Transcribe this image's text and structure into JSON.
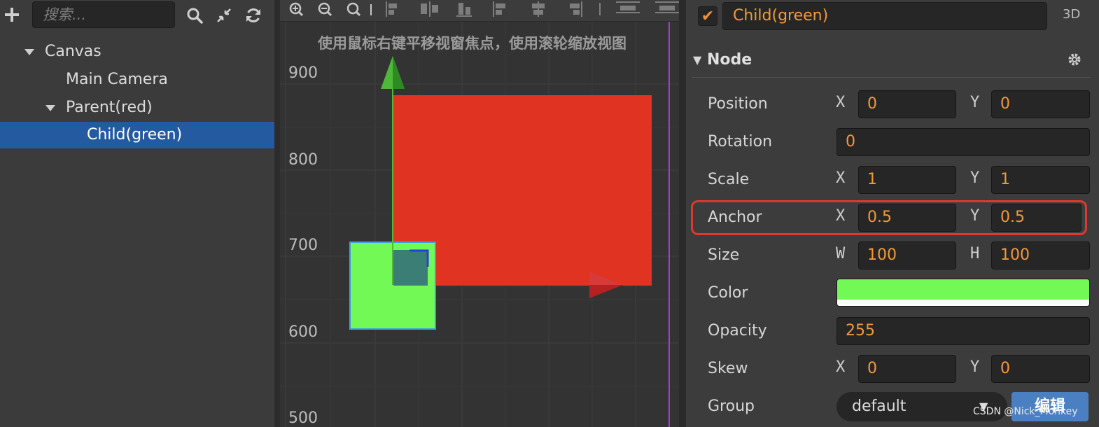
{
  "hierarchy": {
    "search_placeholder": "搜索...",
    "tree": [
      {
        "label": "Canvas",
        "level": 0,
        "expanded": true
      },
      {
        "label": "Main Camera",
        "level": 1
      },
      {
        "label": "Parent(red)",
        "level": 1,
        "expanded": true
      },
      {
        "label": "Child(green)",
        "level": 2,
        "selected": true
      }
    ],
    "icons": [
      "plus-icon",
      "search-icon",
      "collapse-icon",
      "refresh-icon"
    ]
  },
  "scene": {
    "hint": "使用鼠标右键平移视窗焦点，使用滚轮缩放视图",
    "y_ruler": [
      "900",
      "800",
      "700",
      "600",
      "500"
    ],
    "colors": {
      "parent": "#e03322",
      "child": "#72f956",
      "overlap": "#3a7e75",
      "gizmo_y": "#4fb83b",
      "gizmo_x": "#c42323"
    }
  },
  "inspector": {
    "active": true,
    "node_name": "Child(green)",
    "mode": "3D",
    "section": "Node",
    "properties": {
      "position": {
        "label": "Position",
        "x_label": "X",
        "x": "0",
        "y_label": "Y",
        "y": "0"
      },
      "rotation": {
        "label": "Rotation",
        "value": "0"
      },
      "scale": {
        "label": "Scale",
        "x_label": "X",
        "x": "1",
        "y_label": "Y",
        "y": "1"
      },
      "anchor": {
        "label": "Anchor",
        "x_label": "X",
        "x": "0.5",
        "y_label": "Y",
        "y": "0.5"
      },
      "size": {
        "label": "Size",
        "w_label": "W",
        "w": "100",
        "h_label": "H",
        "h": "100"
      },
      "color": {
        "label": "Color",
        "value": "#72f956"
      },
      "opacity": {
        "label": "Opacity",
        "value": "255"
      },
      "skew": {
        "label": "Skew",
        "x_label": "X",
        "x": "0",
        "y_label": "Y",
        "y": "0"
      },
      "group": {
        "label": "Group",
        "value": "default",
        "edit_label": "编辑"
      }
    }
  },
  "watermark": "CSDN @Nick_Monkey"
}
